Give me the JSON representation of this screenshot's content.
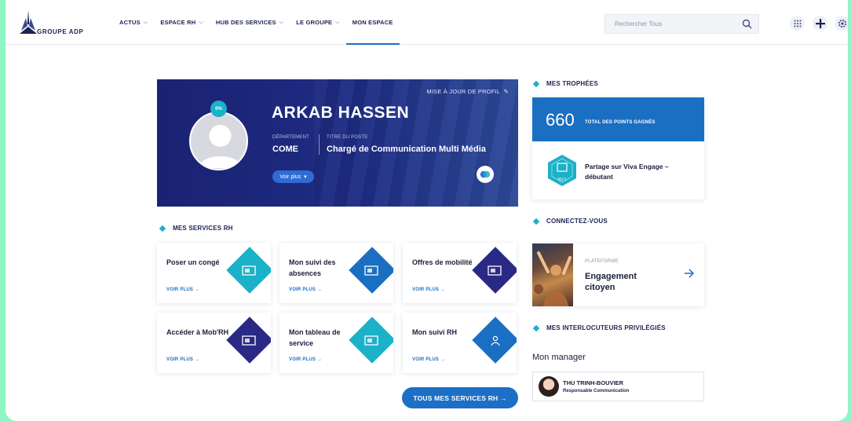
{
  "brand": {
    "name": "GROUPE ADP"
  },
  "nav": {
    "items": [
      {
        "label": "ACTUS",
        "has_menu": true
      },
      {
        "label": "ESPACE RH",
        "has_menu": true
      },
      {
        "label": "HUB DES SERVICES",
        "has_menu": true
      },
      {
        "label": "LE GROUPE",
        "has_menu": true
      },
      {
        "label": "MON ESPACE",
        "has_menu": false,
        "active": true
      }
    ]
  },
  "search": {
    "placeholder": "Rechercher Tous"
  },
  "header_icons": [
    "apps-grid-icon",
    "plus-icon",
    "settings-icon"
  ],
  "profile": {
    "update_link": "MISE À JOUR DE PROFIL",
    "completion": "0%",
    "name": "ARKAB HASSEN",
    "department_label": "DÉPARTEMENT",
    "department": "COME",
    "job_title_label": "TITRE DU POSTE",
    "job_title": "Chargé de Communication Multi Média",
    "more_button": "Voir plus"
  },
  "services": {
    "title": "MES SERVICES RH",
    "link_label": "VOIR PLUS →",
    "items": [
      {
        "label": "Poser un congé",
        "color": "#1bb1c9"
      },
      {
        "label": "Mon suivi des absences",
        "color": "#1b6fc2"
      },
      {
        "label": "Offres de mobilité",
        "color": "#2a2a86"
      },
      {
        "label": "Accéder à Mob'RH",
        "color": "#2a2a86"
      },
      {
        "label": "Mon tableau de service",
        "color": "#1bb1c9"
      },
      {
        "label": "Mon suivi RH",
        "color": "#1b6fc2"
      }
    ],
    "all_button": "TOUS MES SERVICES RH →"
  },
  "trophies": {
    "title": "MES TROPHÉES",
    "points": "660",
    "points_label": "TOTAL DES POINTS GAGNÉS",
    "badge_label": "Partage sur Viva Engage – débutant",
    "badge_level": "NV.1"
  },
  "connect": {
    "title": "CONNECTEZ-VOUS",
    "platform_label": "PLATEFORME",
    "platform_name": "Engagement citoyen"
  },
  "contacts": {
    "title": "MES INTERLOCUTEURS PRIVILÉGIÉS",
    "manager_label": "Mon manager",
    "manager_name": "THU TRINH-BOUVIER",
    "manager_role": "Responsable Communication"
  },
  "colors": {
    "navy": "#1c2354",
    "accent_blue": "#1b6fc2",
    "cyan": "#1bb1c9",
    "border": "#8ff5c4"
  }
}
